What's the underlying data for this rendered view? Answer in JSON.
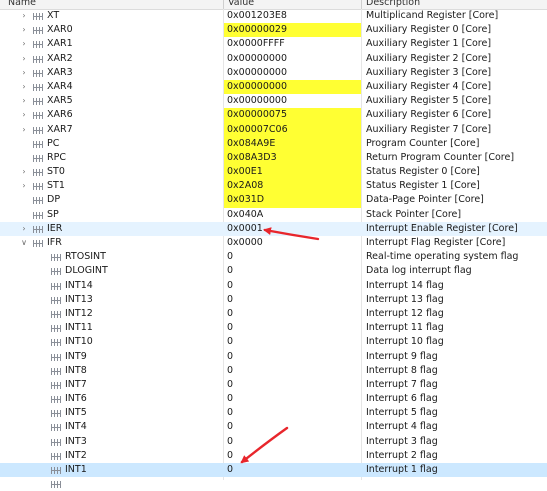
{
  "header": {
    "name": "Name",
    "value": "Value",
    "description": "Description"
  },
  "colors": {
    "highlight": "#ffff33",
    "selection": "#cce8ff",
    "hover": "#e5f3ff",
    "arrow": "#e8262c"
  },
  "rows": [
    {
      "name": "XT",
      "value": "0x001203E8",
      "desc": "Multiplicand Register [Core]",
      "level": 0,
      "twisty": ">",
      "hl": false
    },
    {
      "name": "XAR0",
      "value": "0x00000029",
      "desc": "Auxiliary Register 0 [Core]",
      "level": 0,
      "twisty": ">",
      "hl": true
    },
    {
      "name": "XAR1",
      "value": "0x0000FFFF",
      "desc": "Auxiliary Register 1 [Core]",
      "level": 0,
      "twisty": ">",
      "hl": false
    },
    {
      "name": "XAR2",
      "value": "0x00000000",
      "desc": "Auxiliary Register 2 [Core]",
      "level": 0,
      "twisty": ">",
      "hl": false
    },
    {
      "name": "XAR3",
      "value": "0x00000000",
      "desc": "Auxiliary Register 3 [Core]",
      "level": 0,
      "twisty": ">",
      "hl": false
    },
    {
      "name": "XAR4",
      "value": "0x00000000",
      "desc": "Auxiliary Register 4 [Core]",
      "level": 0,
      "twisty": ">",
      "hl": true
    },
    {
      "name": "XAR5",
      "value": "0x00000000",
      "desc": "Auxiliary Register 5 [Core]",
      "level": 0,
      "twisty": ">",
      "hl": false
    },
    {
      "name": "XAR6",
      "value": "0x00000075",
      "desc": "Auxiliary Register 6 [Core]",
      "level": 0,
      "twisty": ">",
      "hl": true
    },
    {
      "name": "XAR7",
      "value": "0x00007C06",
      "desc": "Auxiliary Register 7 [Core]",
      "level": 0,
      "twisty": ">",
      "hl": true
    },
    {
      "name": "PC",
      "value": "0x084A9E",
      "desc": "Program Counter [Core]",
      "level": 0,
      "twisty": "",
      "hl": true
    },
    {
      "name": "RPC",
      "value": "0x08A3D3",
      "desc": "Return Program Counter [Core]",
      "level": 0,
      "twisty": "",
      "hl": true
    },
    {
      "name": "ST0",
      "value": "0x00E1",
      "desc": "Status Register 0 [Core]",
      "level": 0,
      "twisty": ">",
      "hl": true
    },
    {
      "name": "ST1",
      "value": "0x2A08",
      "desc": "Status Register 1 [Core]",
      "level": 0,
      "twisty": ">",
      "hl": true
    },
    {
      "name": "DP",
      "value": "0x031D",
      "desc": "Data-Page Pointer [Core]",
      "level": 0,
      "twisty": "",
      "hl": true
    },
    {
      "name": "SP",
      "value": "0x040A",
      "desc": "Stack Pointer [Core]",
      "level": 0,
      "twisty": "",
      "hl": false
    },
    {
      "name": "IER",
      "value": "0x0001",
      "desc": "Interrupt Enable Register [Core]",
      "level": 0,
      "twisty": ">",
      "hl": false,
      "hover": true
    },
    {
      "name": "IFR",
      "value": "0x0000",
      "desc": "Interrupt Flag Register [Core]",
      "level": 0,
      "twisty": "v",
      "hl": false
    },
    {
      "name": "RTOSINT",
      "value": "0",
      "desc": "Real-time operating system flag",
      "level": 1,
      "twisty": "",
      "hl": false
    },
    {
      "name": "DLOGINT",
      "value": "0",
      "desc": "Data log interrupt flag",
      "level": 1,
      "twisty": "",
      "hl": false
    },
    {
      "name": "INT14",
      "value": "0",
      "desc": "Interrupt 14 flag",
      "level": 1,
      "twisty": "",
      "hl": false
    },
    {
      "name": "INT13",
      "value": "0",
      "desc": "Interrupt 13 flag",
      "level": 1,
      "twisty": "",
      "hl": false
    },
    {
      "name": "INT12",
      "value": "0",
      "desc": "Interrupt 12 flag",
      "level": 1,
      "twisty": "",
      "hl": false
    },
    {
      "name": "INT11",
      "value": "0",
      "desc": "Interrupt 11 flag",
      "level": 1,
      "twisty": "",
      "hl": false
    },
    {
      "name": "INT10",
      "value": "0",
      "desc": "Interrupt 10 flag",
      "level": 1,
      "twisty": "",
      "hl": false
    },
    {
      "name": "INT9",
      "value": "0",
      "desc": "Interrupt 9 flag",
      "level": 1,
      "twisty": "",
      "hl": false
    },
    {
      "name": "INT8",
      "value": "0",
      "desc": "Interrupt 8 flag",
      "level": 1,
      "twisty": "",
      "hl": false
    },
    {
      "name": "INT7",
      "value": "0",
      "desc": "Interrupt 7 flag",
      "level": 1,
      "twisty": "",
      "hl": false
    },
    {
      "name": "INT6",
      "value": "0",
      "desc": "Interrupt 6 flag",
      "level": 1,
      "twisty": "",
      "hl": false
    },
    {
      "name": "INT5",
      "value": "0",
      "desc": "Interrupt 5 flag",
      "level": 1,
      "twisty": "",
      "hl": false
    },
    {
      "name": "INT4",
      "value": "0",
      "desc": "Interrupt 4 flag",
      "level": 1,
      "twisty": "",
      "hl": false
    },
    {
      "name": "INT3",
      "value": "0",
      "desc": "Interrupt 3 flag",
      "level": 1,
      "twisty": "",
      "hl": false
    },
    {
      "name": "INT2",
      "value": "0",
      "desc": "Interrupt 2 flag",
      "level": 1,
      "twisty": "",
      "hl": false
    },
    {
      "name": "INT1",
      "value": "0",
      "desc": "Interrupt 1 flag",
      "level": 1,
      "twisty": "",
      "hl": false,
      "selected": true
    },
    {
      "name": "",
      "value": "",
      "desc": "",
      "level": 1,
      "twisty": "",
      "hl": false
    }
  ]
}
